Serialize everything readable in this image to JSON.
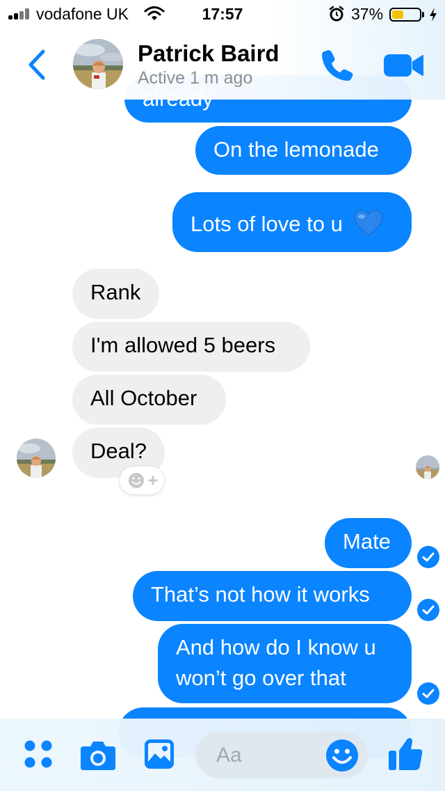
{
  "status_bar": {
    "carrier": "vodafone UK",
    "time": "17:57",
    "battery": "37%",
    "battery_level": 0.37,
    "icons": [
      "signal-icon",
      "wifi-icon",
      "alarm-icon",
      "battery-icon",
      "charging-bolt-icon"
    ]
  },
  "header": {
    "name": "Patrick Baird",
    "status": "Active 1 m ago",
    "icons": [
      "back-chevron-icon",
      "avatar",
      "phone-icon",
      "video-camera-icon"
    ]
  },
  "messages": [
    {
      "from": "me",
      "text": "already"
    },
    {
      "from": "me",
      "text": "On the lemonade"
    },
    {
      "from": "me",
      "text": "Lots of love to u",
      "emoji": "blue-heart-icon"
    },
    {
      "from": "them",
      "text": "Rank"
    },
    {
      "from": "them",
      "text": "I'm allowed 5 beers"
    },
    {
      "from": "them",
      "text": "All October"
    },
    {
      "from": "them",
      "text": "Deal?"
    },
    {
      "from": "me",
      "text": "Mate"
    },
    {
      "from": "me",
      "text": "That’s not how it works"
    },
    {
      "from": "me",
      "text": "And how do I know u won’t go over that"
    }
  ],
  "composer": {
    "placeholder": "Aa",
    "icons": [
      "apps-grid-icon",
      "camera-icon",
      "gallery-icon",
      "emoji-smiley-icon",
      "thumbs-up-icon"
    ]
  },
  "colors": {
    "accent": "#0a84ff",
    "incoming_bubble": "#efefef",
    "battery_fill": "#f2c200"
  }
}
